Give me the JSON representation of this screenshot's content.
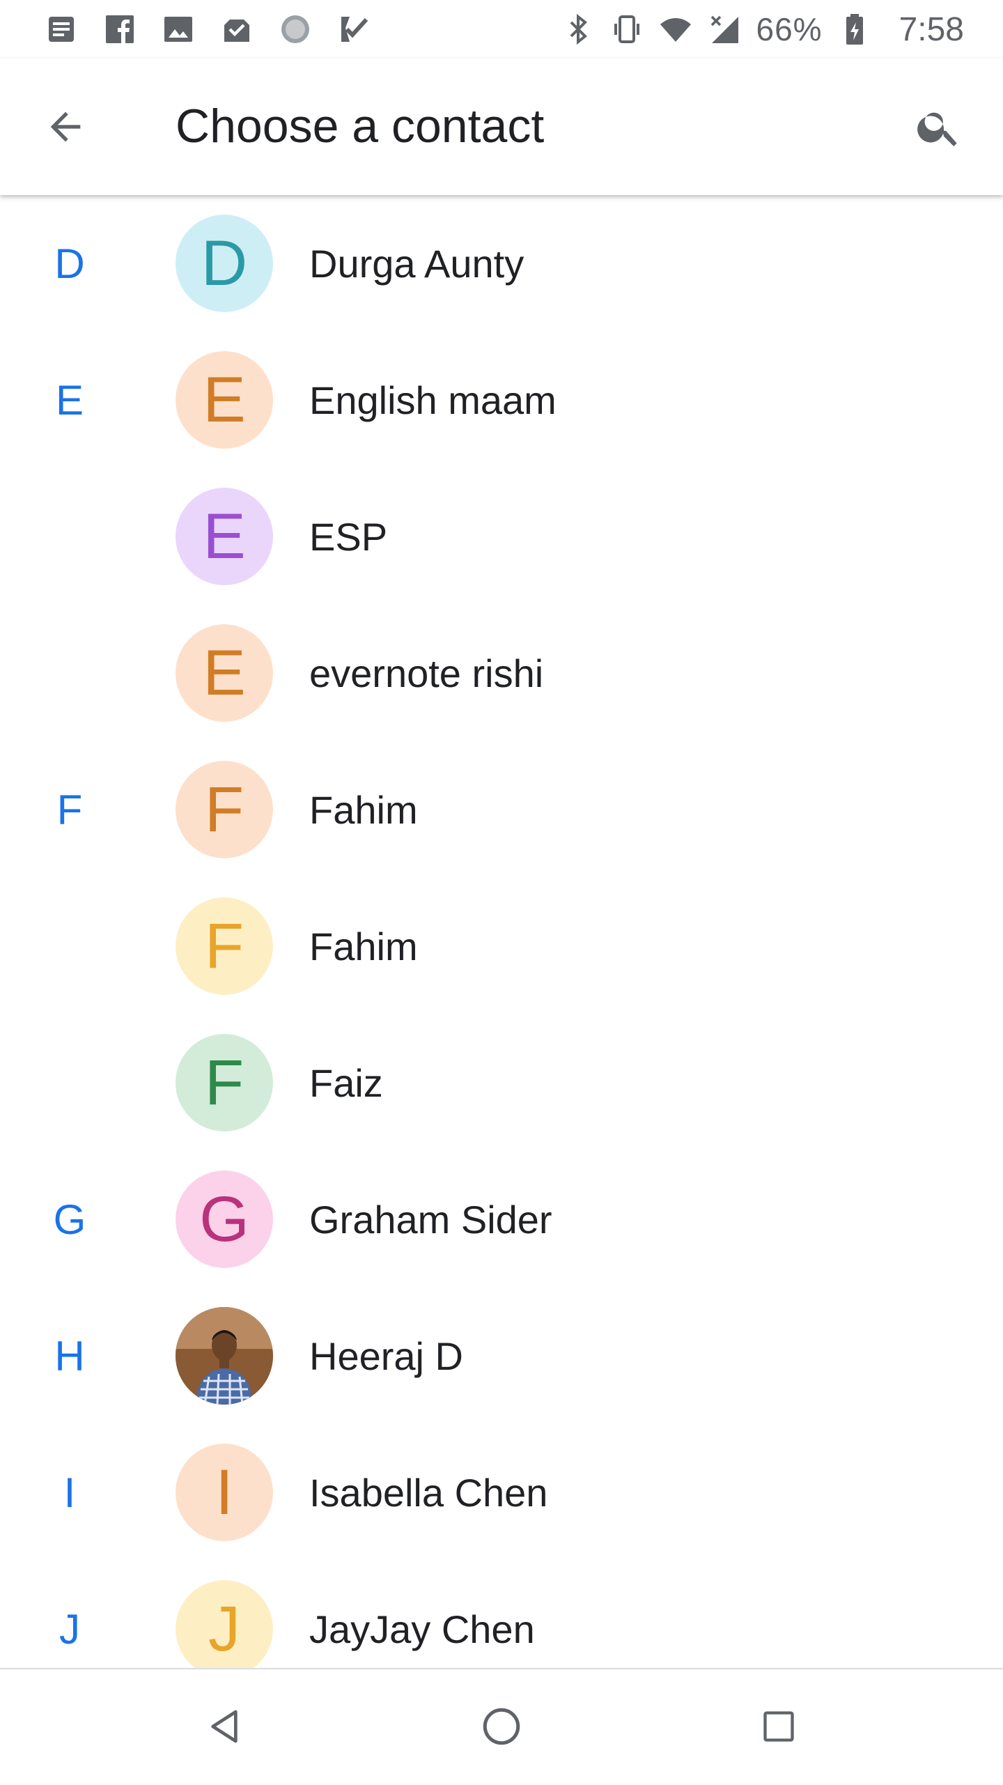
{
  "status_bar": {
    "left_icons": [
      "notes-icon",
      "facebook-icon",
      "image-icon",
      "inbox-done-icon",
      "loading-circle-icon",
      "tasks-check-icon"
    ],
    "right_icons": [
      "bluetooth-icon",
      "vibrate-icon",
      "wifi-icon",
      "cell-signal-icon"
    ],
    "battery_percent": "66%",
    "time": "7:58"
  },
  "app_bar": {
    "title": "Choose a contact",
    "back_icon": "arrow-back-icon",
    "search_icon": "search-icon"
  },
  "contacts": [
    {
      "section": "D",
      "initial": "D",
      "name": "Durga Aunty",
      "avatar_bg": "#ceeef5",
      "avatar_fg": "#2a9aa6"
    },
    {
      "section": "E",
      "initial": "E",
      "name": "English maam",
      "avatar_bg": "#fde0cb",
      "avatar_fg": "#d17c26"
    },
    {
      "section": "",
      "initial": "E",
      "name": "ESP",
      "avatar_bg": "#ead6fb",
      "avatar_fg": "#9a4fd1"
    },
    {
      "section": "",
      "initial": "E",
      "name": "evernote rishi",
      "avatar_bg": "#fde0cb",
      "avatar_fg": "#d17c26"
    },
    {
      "section": "F",
      "initial": "F",
      "name": "Fahim",
      "avatar_bg": "#fde0cb",
      "avatar_fg": "#d17c26"
    },
    {
      "section": "",
      "initial": "F",
      "name": "Fahim",
      "avatar_bg": "#fdefc3",
      "avatar_fg": "#e8a52a"
    },
    {
      "section": "",
      "initial": "F",
      "name": "Faiz",
      "avatar_bg": "#d2ecd9",
      "avatar_fg": "#2e8a4b"
    },
    {
      "section": "G",
      "initial": "G",
      "name": "Graham Sider",
      "avatar_bg": "#fcd1ea",
      "avatar_fg": "#b8337b"
    },
    {
      "section": "H",
      "initial": "",
      "name": "Heeraj D",
      "avatar_bg": "#a0673d",
      "avatar_fg": "#ffffff",
      "photo": true
    },
    {
      "section": "I",
      "initial": "I",
      "name": "Isabella Chen",
      "avatar_bg": "#fde0cb",
      "avatar_fg": "#d17c26"
    },
    {
      "section": "J",
      "initial": "J",
      "name": "JayJay Chen",
      "avatar_bg": "#fdefc3",
      "avatar_fg": "#e8a52a"
    }
  ],
  "nav_bar": {
    "back": "nav-back-icon",
    "home": "nav-home-icon",
    "recents": "nav-recents-icon"
  },
  "colors": {
    "accent": "#1a73e8",
    "text_primary": "#202124",
    "icon_grey": "#5f6368"
  }
}
